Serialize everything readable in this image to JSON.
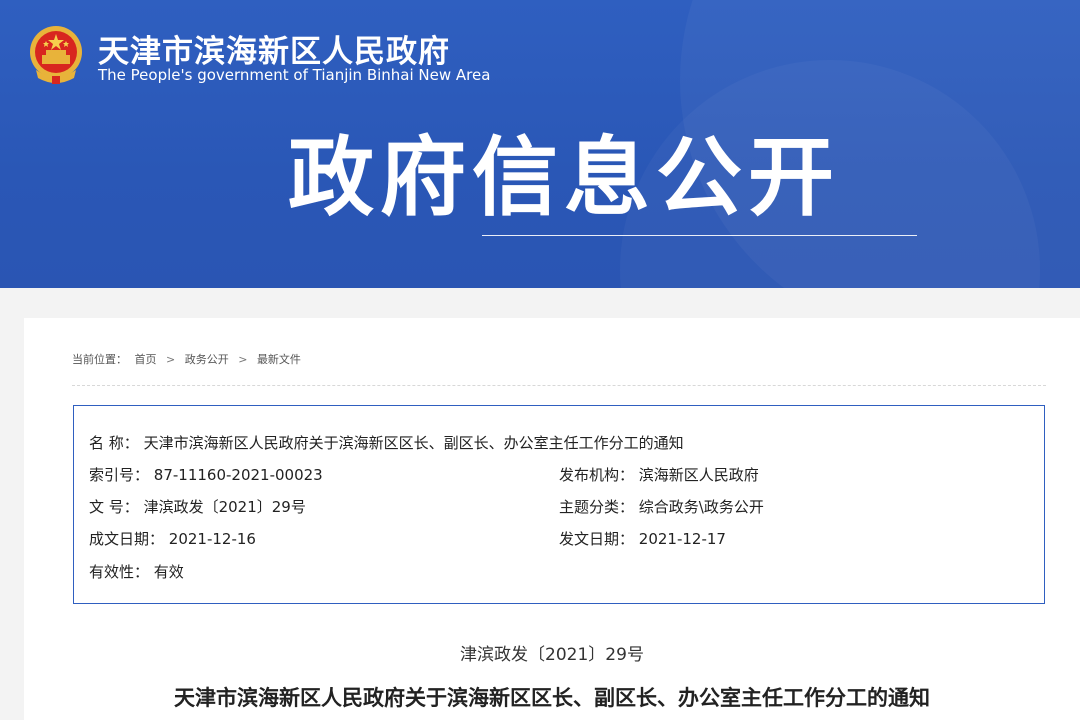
{
  "header": {
    "site_title": "天津市滨海新区人民政府",
    "site_subtitle": "The People's government of Tianjin Binhai New Area",
    "section_title": "政府信息公开",
    "emblem_icon": "national-emblem-icon",
    "colors": {
      "banner": "#2f5fc0",
      "border": "#2f5fc0"
    }
  },
  "breadcrumb": {
    "prefix": "当前位置：",
    "items": [
      "首页",
      "政务公开",
      "最新文件"
    ],
    "separator": ">"
  },
  "meta": {
    "name_label": "名  称：",
    "name_value": "天津市滨海新区人民政府关于滨海新区区长、副区长、办公室主任工作分工的通知",
    "index_label": "索引号：",
    "index_value": "87-11160-2021-00023",
    "publisher_label": "发布机构：",
    "publisher_value": "滨海新区人民政府",
    "docno_label": "文  号：",
    "docno_value": "津滨政发〔2021〕29号",
    "topic_label": "主题分类：",
    "topic_value": "综合政务\\政务公开",
    "written_label": "成文日期：",
    "written_value": "2021-12-16",
    "published_label": "发文日期：",
    "published_value": "2021-12-17",
    "validity_label": "有效性：",
    "validity_value": "有效"
  },
  "document": {
    "number": "津滨政发〔2021〕29号",
    "title": "天津市滨海新区人民政府关于滨海新区区长、副区长、办公室主任工作分工的通知"
  }
}
